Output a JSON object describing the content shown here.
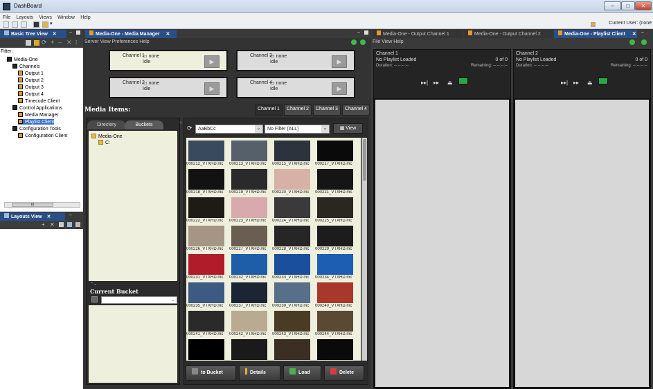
{
  "window": {
    "title": "DashBoard",
    "controls": [
      "–",
      "□",
      "✕"
    ]
  },
  "menubar": {
    "items": [
      "File",
      "Layouts",
      "Views",
      "Window",
      "Help"
    ]
  },
  "toolbar": {
    "current_user": "Current User: (none"
  },
  "tree_panel": {
    "tab_label": "Basic Tree View",
    "filter_label": "Filter:",
    "items": [
      "Media-One",
      "Channels",
      "Output 1",
      "Output 2",
      "Output 3",
      "Output 4",
      "Timecode Client",
      "Control Applications",
      "Media Manager",
      "Playlist Client",
      "Configuration Tools",
      "Configuration Client"
    ],
    "scroll_marker": "III"
  },
  "layouts_panel": {
    "tab_label": "Layouts View"
  },
  "media_manager": {
    "tab_label": "Media-One - Media Manager",
    "menu": [
      "Server",
      "View",
      "Preferences",
      "Help"
    ],
    "channels": [
      {
        "name": "Channel 1",
        "clip": "none",
        "state": "Idle"
      },
      {
        "name": "Channel 2",
        "clip": "none",
        "state": "Idle"
      },
      {
        "name": "Channel 3",
        "clip": "none",
        "state": "Idle"
      },
      {
        "name": "Channel 4",
        "clip": "none",
        "state": "Idle"
      }
    ],
    "media_items_label": "Media Items:",
    "channel_buttons": [
      "Channel 1",
      "Channel 2",
      "Channel 3",
      "Channel 4"
    ],
    "left_tabs": [
      "Directory",
      "Buckets"
    ],
    "dir_tree": [
      "Media-One",
      "C:"
    ],
    "current_bucket_label": "Current Bucket",
    "search_value": "AaBbCc",
    "filter_value": "No Filter (ALL)",
    "view_label": "View",
    "thumbnails": [
      "000212_VTXHD.mc",
      "000213_VTXHD.mc",
      "000215_VTXHD.mc",
      "000217_VTXHD.mc",
      "000218_VTXHD.mc",
      "000219_VTXHD.mc",
      "000220_VTXHD.mc",
      "000221_VTXHD.mc",
      "000222_VTXHD.mc",
      "000223_VTXHD.mc",
      "000224_VTXHD.mc",
      "000225_VTXHD.mc",
      "000226_VTXHD.mc",
      "000227_VTXHD.mc",
      "000228_VTXHD.mc",
      "000229_VTXHD.mc",
      "000231_VTXHD.mc",
      "000232_VTXHD.mc",
      "000233_VTXHD.mc",
      "000234_VTXHD.mc",
      "000235_VTXHD.mc",
      "000237_VTXHD.mc",
      "000239_VTXHD.mc",
      "000240_VTXHD.mc",
      "000241_VTXHD.mc",
      "000242_VTXHD.mc",
      "000243_VTXHD.mc",
      "000244_VTXHD.mc",
      "",
      "",
      "",
      ""
    ],
    "thumb_colors": [
      "#3a4a5e",
      "#55606b",
      "#2c333d",
      "#0a0a0a",
      "#121212",
      "#2a2a2a",
      "#d6b2a6",
      "#151515",
      "#1e1a14",
      "#d8a9ad",
      "#3a3a3a",
      "#2a2620",
      "#a59683",
      "#6a5e52",
      "#262626",
      "#1c1c1c",
      "#b01c2a",
      "#1e5ea8",
      "#1a4f9e",
      "#1d5db2",
      "#3c5a82",
      "#1c2533",
      "#586f8a",
      "#a8382c",
      "#2a2a2a",
      "#b8ab92",
      "#4a3b24",
      "#5a4a34",
      "#000000",
      "#1a1a1a",
      "#3a2f22",
      "#0a0a0a"
    ],
    "action_buttons": [
      "to Bucket",
      "Details",
      "Load",
      "Delete"
    ]
  },
  "right_tabs": [
    "Media-One - Output Channel 1",
    "Media-One - Output Channel 2",
    "Media-One - Playlist Client"
  ],
  "playlist_client": {
    "menu": [
      "File",
      "View",
      "Help"
    ],
    "channels": [
      {
        "name": "Channel 1",
        "playlist": "No Playlist Loaded",
        "count": "0 of 0",
        "duration_label": "Duration:",
        "duration": "--:--:--:--",
        "remaining_label": "Remaining:",
        "remaining": "--:--:--:--"
      },
      {
        "name": "Channel 2",
        "playlist": "No Playlist Loaded",
        "count": "0 of 0",
        "duration_label": "Duration:",
        "duration": "--:--:--:--",
        "remaining_label": "Remaining:",
        "remaining": "--:--:--:--"
      }
    ],
    "control_glyphs": [
      "▸▸|",
      "▸▸",
      "⏏"
    ]
  }
}
